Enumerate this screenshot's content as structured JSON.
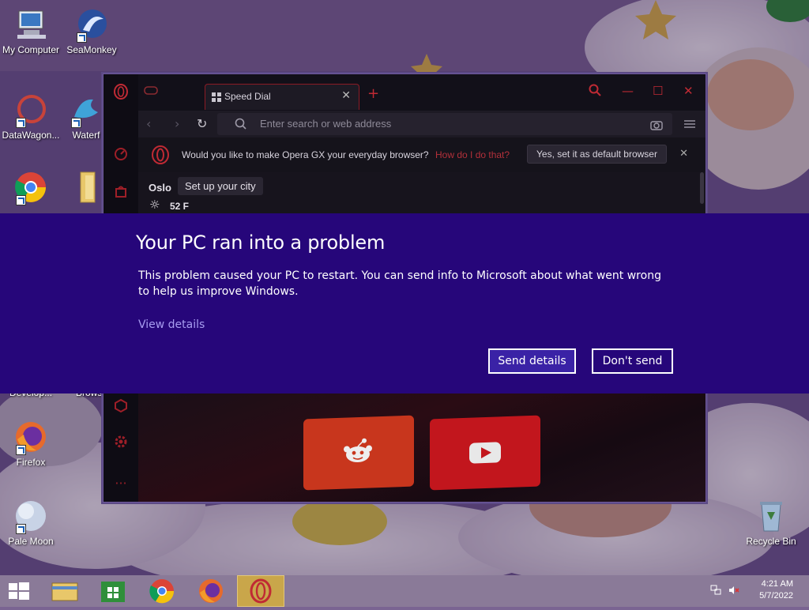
{
  "desktop": {
    "icons": [
      {
        "label": "My Computer",
        "icon": "computer-icon"
      },
      {
        "label": "SeaMonkey",
        "icon": "seamonkey-icon"
      },
      {
        "label": "DataWagon...",
        "icon": "datawagon-icon"
      },
      {
        "label": "Waterf",
        "icon": "waterfox-icon"
      },
      {
        "label": "",
        "icon": "chrome-icon"
      },
      {
        "label": "",
        "icon": "folder-icon"
      },
      {
        "label": "Firefox",
        "icon": "firefox-icon"
      },
      {
        "label": "Pale Moon",
        "icon": "palemoon-icon"
      },
      {
        "label": "Recycle Bin",
        "icon": "recycle-bin-icon"
      }
    ],
    "obscured_labels": [
      "Develop...",
      "Brows"
    ]
  },
  "opera": {
    "tab_label": "Speed Dial",
    "address_placeholder": "Enter search or web address",
    "banner_question": "Would you like to make Opera GX your everyday browser?",
    "banner_how": "How do I do that?",
    "banner_yes": "Yes, set it as default browser",
    "city": "Oslo",
    "set_city": "Set up your city",
    "temperature": "52 F",
    "accent_color": "#c02a34"
  },
  "error_dialog": {
    "title": "Your PC ran into a problem",
    "message": "This problem caused your PC to restart. You can send info to Microsoft about what went wrong to help us improve Windows.",
    "view_details": "View details",
    "send_button": "Send details",
    "dont_send_button": "Don't send",
    "background_color": "#26067a"
  },
  "taskbar": {
    "time": "4:21 AM",
    "date": "5/7/2022",
    "pinned": [
      "start-button",
      "file-explorer",
      "store",
      "chrome",
      "firefox",
      "opera-gx"
    ]
  }
}
